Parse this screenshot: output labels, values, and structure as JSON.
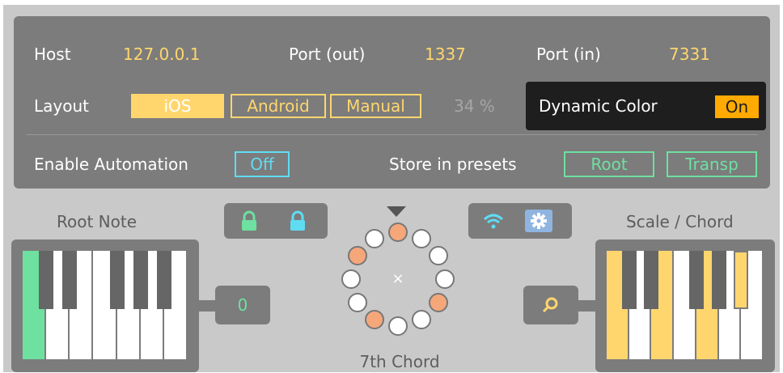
{
  "connection": {
    "host_label": "Host",
    "host_value": "127.0.0.1",
    "port_out_label": "Port (out)",
    "port_out_value": "1337",
    "port_in_label": "Port (in)",
    "port_in_value": "7331"
  },
  "layout": {
    "label": "Layout",
    "options": [
      "iOS",
      "Android",
      "Manual"
    ],
    "selected": "iOS",
    "percent": "34 %"
  },
  "dynamic_color": {
    "label": "Dynamic Color",
    "value": "On"
  },
  "automation": {
    "label": "Enable Automation",
    "value": "Off"
  },
  "presets": {
    "label": "Store in presets",
    "options": [
      "Root",
      "Transp"
    ]
  },
  "root_note": {
    "label": "Root Note",
    "value": "0"
  },
  "scale_chord": {
    "label": "Scale / Chord"
  },
  "chord": {
    "label": "7th Chord",
    "center_symbol": "×"
  },
  "colors": {
    "accent_yellow": "#ffd66e",
    "accent_orange": "#ffaa00",
    "accent_green": "#6ee0a0",
    "accent_cyan": "#5fdcf2",
    "circle_active": "#f5a77a",
    "panel_gray": "#7c7c7c"
  },
  "icons": [
    "lock-icon",
    "lock-icon",
    "triangle-down-icon",
    "wifi-icon",
    "gear-icon",
    "search-icon"
  ]
}
